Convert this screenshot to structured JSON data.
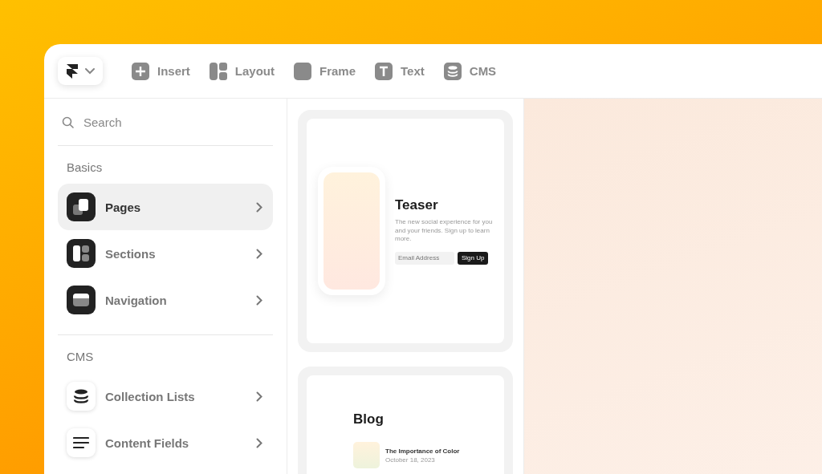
{
  "toolbar": {
    "items": [
      {
        "kind": "insert",
        "label": "Insert"
      },
      {
        "kind": "layout",
        "label": "Layout"
      },
      {
        "kind": "frame",
        "label": "Frame"
      },
      {
        "kind": "text",
        "label": "Text"
      },
      {
        "kind": "cms",
        "label": "CMS"
      }
    ]
  },
  "sidebar": {
    "search": {
      "placeholder": "Search"
    },
    "sections": [
      {
        "title": "Basics",
        "items": [
          {
            "kind": "pages",
            "label": "Pages",
            "selected": true
          },
          {
            "kind": "sections",
            "label": "Sections",
            "selected": false
          },
          {
            "kind": "navigation",
            "label": "Navigation",
            "selected": false
          }
        ]
      },
      {
        "title": "CMS",
        "items": [
          {
            "kind": "collection",
            "label": "Collection Lists",
            "selected": false
          },
          {
            "kind": "fields",
            "label": "Content Fields",
            "selected": false
          }
        ]
      }
    ]
  },
  "templates": [
    {
      "kind": "teaser",
      "title": "Teaser",
      "text": "The new social experience for you and your friends. Sign up to learn more.",
      "placeholder": "Email Address",
      "button": "Sign Up"
    },
    {
      "kind": "blog",
      "title": "Blog",
      "post_title": "The Importance of Color",
      "post_date": "October 18, 2023"
    }
  ]
}
